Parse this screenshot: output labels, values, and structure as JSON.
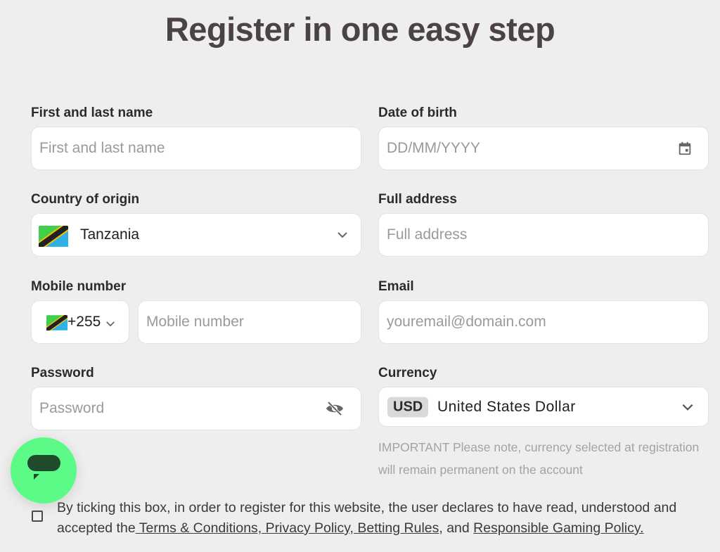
{
  "page": {
    "title": "Register in one easy step"
  },
  "form": {
    "full_name": {
      "label": "First and last name",
      "placeholder": "First and last name",
      "value": ""
    },
    "dob": {
      "label": "Date of birth",
      "placeholder": "DD/MM/YYYY",
      "value": "",
      "icon": "calendar-icon"
    },
    "country": {
      "label": "Country of origin",
      "selected": "Tanzania",
      "flag": "tanzania-flag-icon"
    },
    "address": {
      "label": "Full address",
      "placeholder": "Full address",
      "value": ""
    },
    "mobile": {
      "label": "Mobile number",
      "dial_code": "+255",
      "placeholder": "Mobile number",
      "value": "",
      "flag": "tanzania-flag-icon"
    },
    "email": {
      "label": "Email",
      "placeholder": "youremail@domain.com",
      "value": ""
    },
    "password": {
      "label": "Password",
      "placeholder": "Password",
      "value": "",
      "icon": "eye-off-icon"
    },
    "currency": {
      "label": "Currency",
      "code": "USD",
      "name": "United States Dollar",
      "note": "IMPORTANT Please note, currency selected at registration will remain permanent on the account"
    },
    "consent": {
      "checked": false,
      "text_start": "By ticking this box, in order to register for this website, the user declares to have read, understood and accepted the",
      "link_terms": " Terms & Conditions,",
      "link_privacy": " Privacy Policy,",
      "link_betting": " Betting Rules",
      "text_mid": ", and ",
      "link_responsible": "Responsible Gaming Policy."
    }
  },
  "chat_button": {
    "icon": "chat-bubble-icon"
  },
  "colors": {
    "background": "#eeeeee",
    "title": "#4a4244",
    "chat_accent": "#5cfb87",
    "chat_icon": "#1f4a2c",
    "placeholder": "#9a9a9a"
  }
}
